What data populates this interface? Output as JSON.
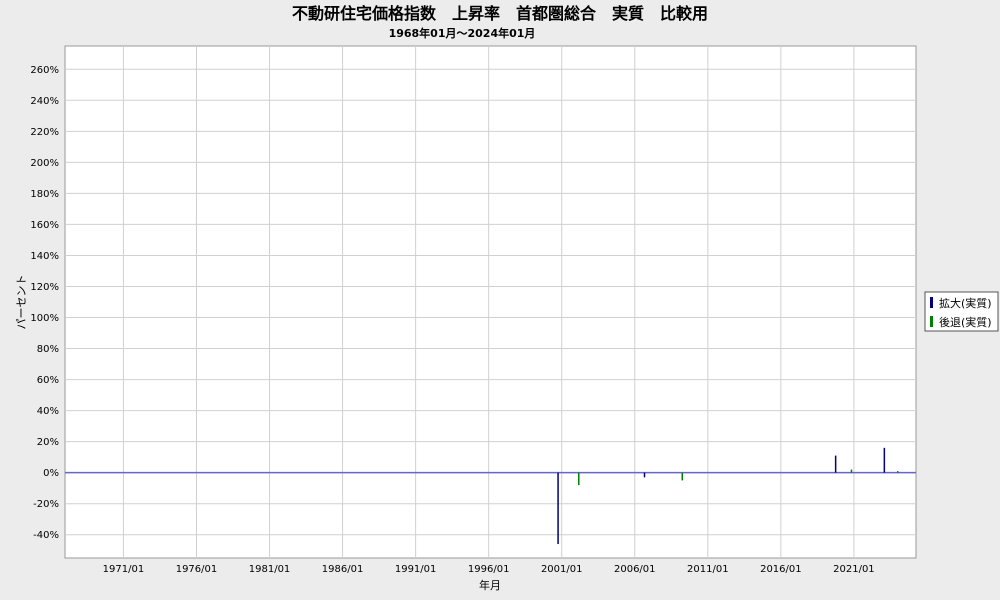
{
  "chart_data": {
    "type": "bar",
    "title": "不動研住宅価格指数　上昇率　首都圏総合　実質　比較用",
    "subtitle": "1968年01月～2024年01月",
    "xlabel": "年月",
    "ylabel": "パーセント",
    "x_ticks": [
      "1971/01",
      "1976/01",
      "1981/01",
      "1986/01",
      "1991/01",
      "1996/01",
      "2001/01",
      "2006/01",
      "2011/01",
      "2016/01",
      "2021/01"
    ],
    "xlim": [
      "1967/01",
      "2025/04"
    ],
    "y_ticks": [
      "-40%",
      "-20%",
      "0%",
      "20%",
      "40%",
      "60%",
      "80%",
      "100%",
      "120%",
      "140%",
      "160%",
      "180%",
      "200%",
      "220%",
      "240%",
      "260%"
    ],
    "ylim": [
      -55,
      275
    ],
    "grid": true,
    "legend_position": "right",
    "series": [
      {
        "name": "拡大(実質)",
        "color": "#000080",
        "points": [
          {
            "x": "2000/10",
            "y": -46
          },
          {
            "x": "2006/09",
            "y": -3
          },
          {
            "x": "2019/10",
            "y": 11
          },
          {
            "x": "2023/02",
            "y": 16
          }
        ]
      },
      {
        "name": "後退(実質)",
        "color": "#008000",
        "points": [
          {
            "x": "2002/03",
            "y": -8
          },
          {
            "x": "2009/04",
            "y": -5
          },
          {
            "x": "2020/11",
            "y": 2
          },
          {
            "x": "2024/01",
            "y": 1
          }
        ]
      }
    ],
    "zero_line_color": "#6666cc"
  }
}
